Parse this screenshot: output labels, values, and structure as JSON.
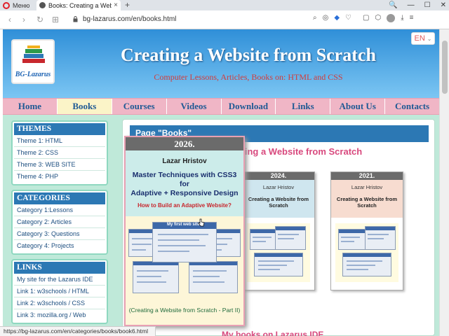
{
  "browser": {
    "menu_label": "Меню",
    "tab_title": "Books: Creating a Website",
    "tab_close": "×",
    "new_tab": "+",
    "url": "bg-lazarus.com/en/books.html",
    "back": "‹",
    "forward": "›",
    "reload": "↻",
    "grid": "⊞",
    "win_min": "—",
    "win_max": "☐",
    "win_close": "✕",
    "search_btn": "🔍"
  },
  "header": {
    "logo_text": "BG-Lazarus",
    "title": "Creating a Website from Scratch",
    "subtitle": "Computer Lessons, Articles, Books on: HTML and CSS",
    "language": "EN"
  },
  "menu": {
    "items": [
      "Home",
      "Books",
      "Courses",
      "Videos",
      "Download",
      "Links",
      "About Us",
      "Contacts"
    ]
  },
  "sidebar": {
    "themes": {
      "title": "THEMES",
      "links": [
        "Theme 1: HTML",
        "Theme 2: CSS",
        "Theme 3: WEB SITE",
        "Theme 4: PHP"
      ]
    },
    "categories": {
      "title": "CATEGORIES",
      "links": [
        "Category 1:Lessons",
        "Category 2: Articles",
        "Category 3: Questions",
        "Category 4: Projects"
      ]
    },
    "links": {
      "title": "LINKS",
      "links": [
        "My site for the Lazarus IDE",
        "Link 1: w3schools / HTML",
        "Link 2: w3schools / CSS",
        "Link 3: mozilla.org / Web"
      ]
    }
  },
  "main": {
    "heading": "Page \"Books\"",
    "subheading": "reating a Website from Scratch",
    "books": [
      {
        "year": "2024.",
        "author": "Lazar Hristov",
        "title": "Creating a Website from Scratch"
      },
      {
        "year": "2021.",
        "author": "Lazar Hristov",
        "title": "Creating a Website from Scratch"
      }
    ],
    "bottom_heading": "My books on Lazarus IDE"
  },
  "popup": {
    "year": "2026.",
    "author": "Lazar Hristov",
    "title_line1": "Master Techniques with CSS3 for",
    "title_line2": "Adaptive + Responsive Design",
    "question": "How to Build an Adaptive Website?",
    "caption": "(Creating a Website from Scratch - Part II)",
    "shot_label": "My first web site"
  },
  "status_url": "https://bg-lazarus.com/en/categories/books/book6.html"
}
